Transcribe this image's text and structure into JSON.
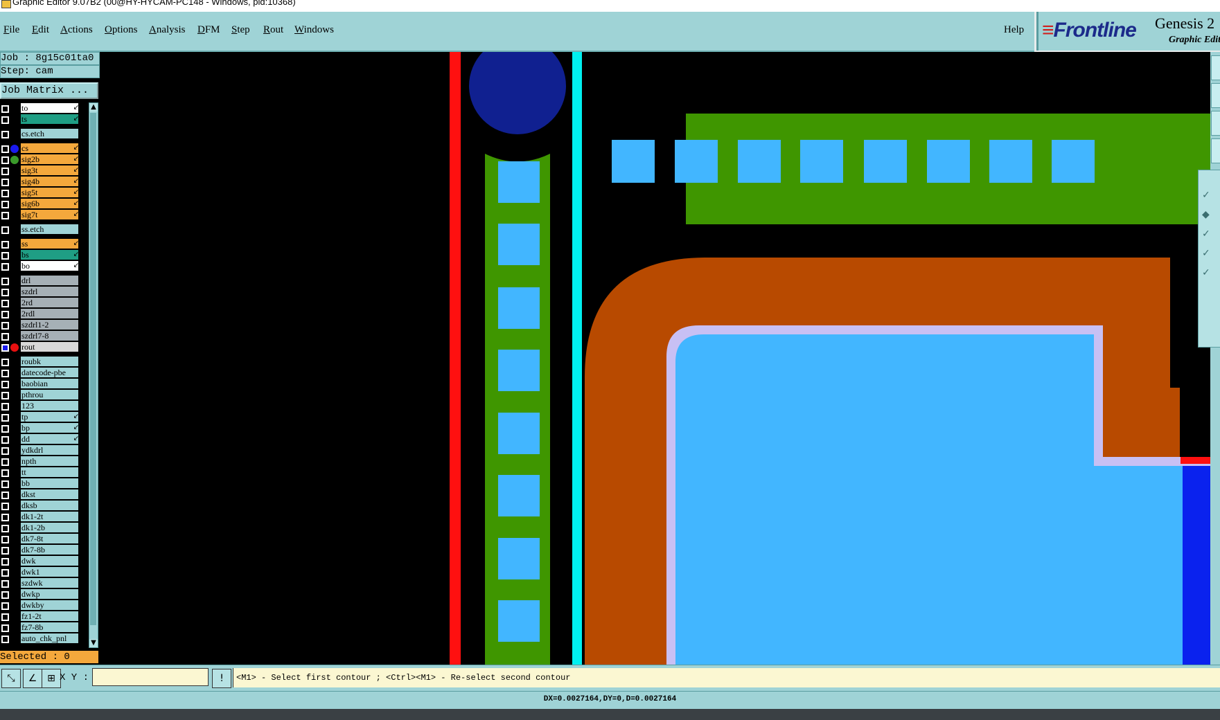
{
  "window": {
    "title": "Graphic Editor 9.07B2 (00@HY-HYCAM-PC148 - Windows, pid:10368)"
  },
  "menu": [
    {
      "label": "File",
      "u": 0
    },
    {
      "label": "Edit",
      "u": 0
    },
    {
      "label": "Actions",
      "u": 0
    },
    {
      "label": "Options",
      "u": 0
    },
    {
      "label": "Analysis",
      "u": 0
    },
    {
      "label": "DFM",
      "u": 0
    },
    {
      "label": "Step",
      "u": 0
    },
    {
      "label": "Rout",
      "u": 0
    },
    {
      "label": "Windows",
      "u": 0
    }
  ],
  "help_label": "Help",
  "brand": {
    "logo": "Frontline",
    "product": "Genesis 2",
    "subtitle": "Graphic Editor"
  },
  "job": {
    "job_text": "Job : 8g15c01ta0",
    "step_text": "Step: cam",
    "matrix_button": "Job Matrix ..."
  },
  "layers": [
    {
      "name": "to",
      "color": "#ffffff",
      "arrow": true
    },
    {
      "name": "ts",
      "color": "#1f9e84",
      "arrow": true
    },
    {
      "name": "cs.etch",
      "color": "#9fd3d6",
      "arrow": false,
      "gap": true
    },
    {
      "name": "cs",
      "color": "#f4a83c",
      "arrow": true,
      "dot": "#1a1aee",
      "gap": true
    },
    {
      "name": "sig2b",
      "color": "#f4a83c",
      "arrow": true,
      "dot": "#3a9a2a"
    },
    {
      "name": "sig3t",
      "color": "#f4a83c",
      "arrow": true
    },
    {
      "name": "sig4b",
      "color": "#f4a83c",
      "arrow": true
    },
    {
      "name": "sig5t",
      "color": "#f4a83c",
      "arrow": true
    },
    {
      "name": "sig6b",
      "color": "#f4a83c",
      "arrow": true
    },
    {
      "name": "sig7t",
      "color": "#f4a83c",
      "arrow": true
    },
    {
      "name": "ss.etch",
      "color": "#9fd3d6",
      "arrow": false,
      "gap": true
    },
    {
      "name": "ss",
      "color": "#f4a83c",
      "arrow": true,
      "gap": true
    },
    {
      "name": "bs",
      "color": "#1f9e84",
      "arrow": true
    },
    {
      "name": "bo",
      "color": "#ffffff",
      "arrow": true
    },
    {
      "name": "drl",
      "color": "#a6b0b6",
      "arrow": false,
      "gap": true
    },
    {
      "name": "szdrl",
      "color": "#a6b0b6",
      "arrow": false
    },
    {
      "name": "2rd",
      "color": "#a6b0b6",
      "arrow": false
    },
    {
      "name": "2rdl",
      "color": "#a6b0b6",
      "arrow": false
    },
    {
      "name": "szdrl1-2",
      "color": "#a6b0b6",
      "arrow": false
    },
    {
      "name": "szdrl7-8",
      "color": "#a6b0b6",
      "arrow": false
    },
    {
      "name": "rout",
      "color": "#d8d8d8",
      "arrow": false,
      "dot": "#e81010",
      "sq": true
    },
    {
      "name": "roubk",
      "color": "#9fd3d6",
      "arrow": false,
      "gap": true
    },
    {
      "name": "datecode-pbe",
      "color": "#9fd3d6",
      "arrow": false
    },
    {
      "name": "baobian",
      "color": "#9fd3d6",
      "arrow": false
    },
    {
      "name": "pthrou",
      "color": "#9fd3d6",
      "arrow": false
    },
    {
      "name": "123",
      "color": "#9fd3d6",
      "arrow": false
    },
    {
      "name": "tp",
      "color": "#9fd3d6",
      "arrow": true
    },
    {
      "name": "bp",
      "color": "#9fd3d6",
      "arrow": true
    },
    {
      "name": "dd",
      "color": "#9fd3d6",
      "arrow": true
    },
    {
      "name": "ydkdrl",
      "color": "#9fd3d6",
      "arrow": false
    },
    {
      "name": "npth",
      "color": "#9fd3d6",
      "arrow": false
    },
    {
      "name": "tt",
      "color": "#9fd3d6",
      "arrow": false
    },
    {
      "name": "bb",
      "color": "#9fd3d6",
      "arrow": false
    },
    {
      "name": "dkst",
      "color": "#9fd3d6",
      "arrow": false
    },
    {
      "name": "dksb",
      "color": "#9fd3d6",
      "arrow": false
    },
    {
      "name": "dk1-2t",
      "color": "#9fd3d6",
      "arrow": false
    },
    {
      "name": "dk1-2b",
      "color": "#9fd3d6",
      "arrow": false
    },
    {
      "name": "dk7-8t",
      "color": "#9fd3d6",
      "arrow": false
    },
    {
      "name": "dk7-8b",
      "color": "#9fd3d6",
      "arrow": false
    },
    {
      "name": "dwk",
      "color": "#9fd3d6",
      "arrow": false
    },
    {
      "name": "dwk1",
      "color": "#9fd3d6",
      "arrow": false
    },
    {
      "name": "szdwk",
      "color": "#9fd3d6",
      "arrow": false
    },
    {
      "name": "dwkp",
      "color": "#9fd3d6",
      "arrow": false
    },
    {
      "name": "dwkby",
      "color": "#9fd3d6",
      "arrow": false
    },
    {
      "name": "fz1-2t",
      "color": "#9fd3d6",
      "arrow": false
    },
    {
      "name": "fz7-8b",
      "color": "#9fd3d6",
      "arrow": false
    },
    {
      "name": "auto_chk_pnl",
      "color": "#9fd3d6",
      "arrow": false
    }
  ],
  "selected_text": "Selected : 0",
  "cmd": {
    "xy_label": "X Y :",
    "xy_value": "",
    "prompt": "<M1> - Select first contour ; <Ctrl><M1> - Re-select second contour"
  },
  "status": "DX=0.0027164,DY=0,D=0.0027164",
  "colors": {
    "panel": "#9fd3d6",
    "canvas_bg": "#000000",
    "copper_green": "#3f9600",
    "pad_blue": "#42b6ff",
    "outline_brown": "#b84a00",
    "rout_lavender": "#c8c0f4",
    "rout_red": "#ff1010",
    "cyan_line": "#00f0f0",
    "circle_navy": "#102090"
  }
}
